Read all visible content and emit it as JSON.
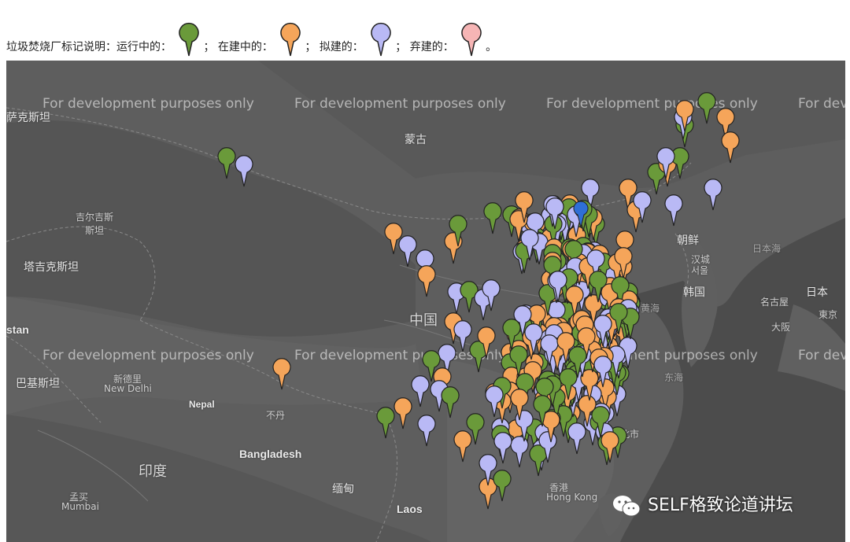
{
  "legend": {
    "prefix": "垃圾焚烧厂标记说明：",
    "items": [
      {
        "label": "运行中的：",
        "color": "#6a9a3a",
        "separator": "；"
      },
      {
        "label": "在建中的：",
        "color": "#f5a55a",
        "separator": "；"
      },
      {
        "label": "拟建的：",
        "color": "#b9b9f5",
        "separator": "；"
      },
      {
        "label": "弃建的：",
        "color": "#f6b5b5",
        "separator": "。"
      }
    ]
  },
  "map": {
    "watermark": "For development purposes only",
    "places": {
      "mongolia": "蒙古",
      "kazakhstan": "萨克斯坦",
      "kyrgyzstan": "吉尔吉斯\n斯坦",
      "tajikistan": "塔吉克斯坦",
      "stan": "stan",
      "pakistan": "巴基斯坦",
      "new_delhi_cn": "新德里",
      "new_delhi_en": "New Delhi",
      "nepal": "Nepal",
      "bhutan": "不丹",
      "bangladesh": "Bangladesh",
      "india": "印度",
      "mumbai_cn": "孟买",
      "mumbai_en": "Mumbai",
      "china": "中国",
      "myanmar": "缅甸",
      "laos": "Laos",
      "north_korea": "朝鲜",
      "seoul_cn": "汉城",
      "seoul_sub": "서울",
      "south_korea": "韩国",
      "sea_of_japan": "日本海",
      "yellow_sea": "黄海",
      "east_sea": "东海",
      "japan": "日本",
      "nagoya": "名古屋",
      "osaka": "大阪",
      "tokyo": "東京",
      "taipei": "台北市",
      "hongkong_cn": "香港",
      "hongkong_en": "Hong Kong"
    },
    "colors": {
      "operating": "#6a9a3a",
      "building": "#f5a55a",
      "planned": "#b9b9f5",
      "abandoned": "#f6b5b5",
      "selected": "#2f6fd6"
    }
  },
  "source": {
    "label": "SELF格致论道讲坛",
    "icon": "wechat-icon"
  }
}
